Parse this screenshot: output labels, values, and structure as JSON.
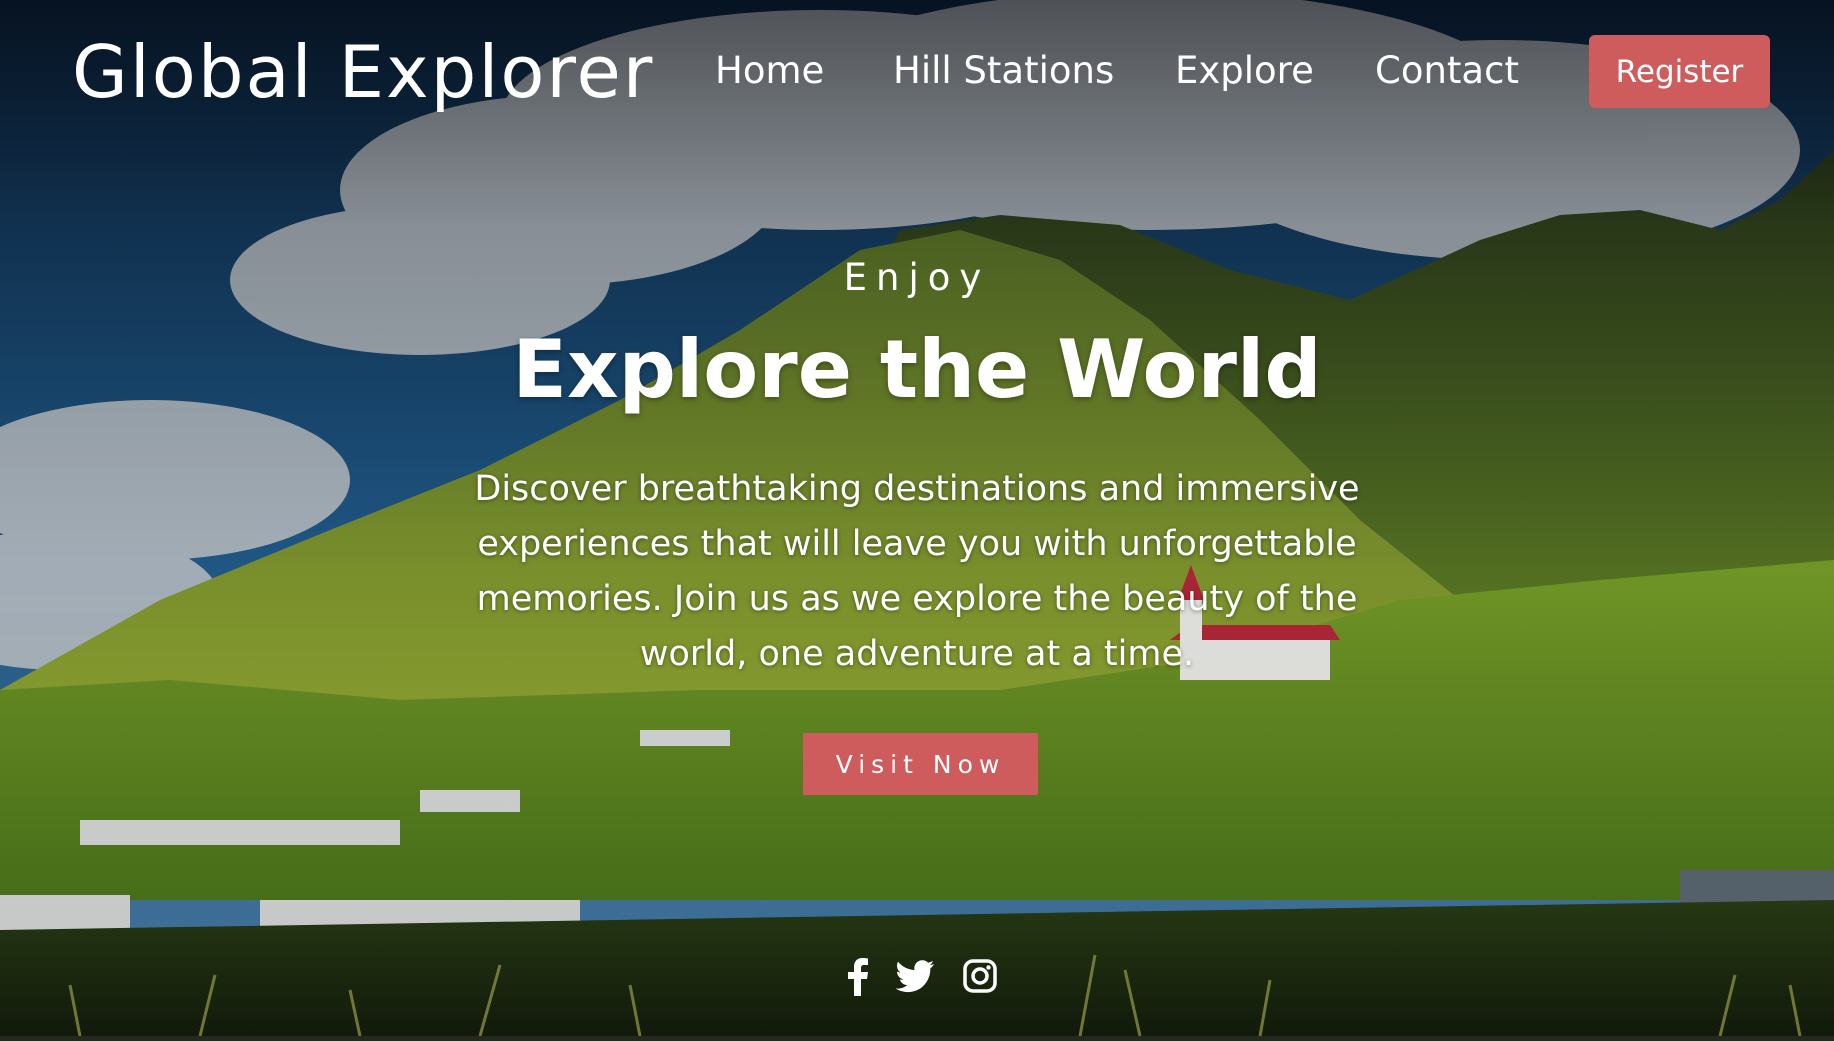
{
  "navbar": {
    "brand": "Global Explorer",
    "links": [
      {
        "label": "Home"
      },
      {
        "label": "Hill Stations"
      },
      {
        "label": "Explore"
      },
      {
        "label": "Contact"
      }
    ],
    "register_label": "Register"
  },
  "hero": {
    "eyebrow": "Enjoy",
    "title": "Explore the World",
    "description": "Discover breathtaking destinations and immersive experiences that will leave you with unforgettable memories. Join us as we explore the beauty of the world, one adventure at a time.",
    "cta_label": "Visit Now"
  },
  "social": {
    "icons": [
      "facebook-icon",
      "twitter-icon",
      "instagram-icon"
    ]
  },
  "colors": {
    "accent": "#cf5c5d",
    "text": "#ffffff"
  }
}
